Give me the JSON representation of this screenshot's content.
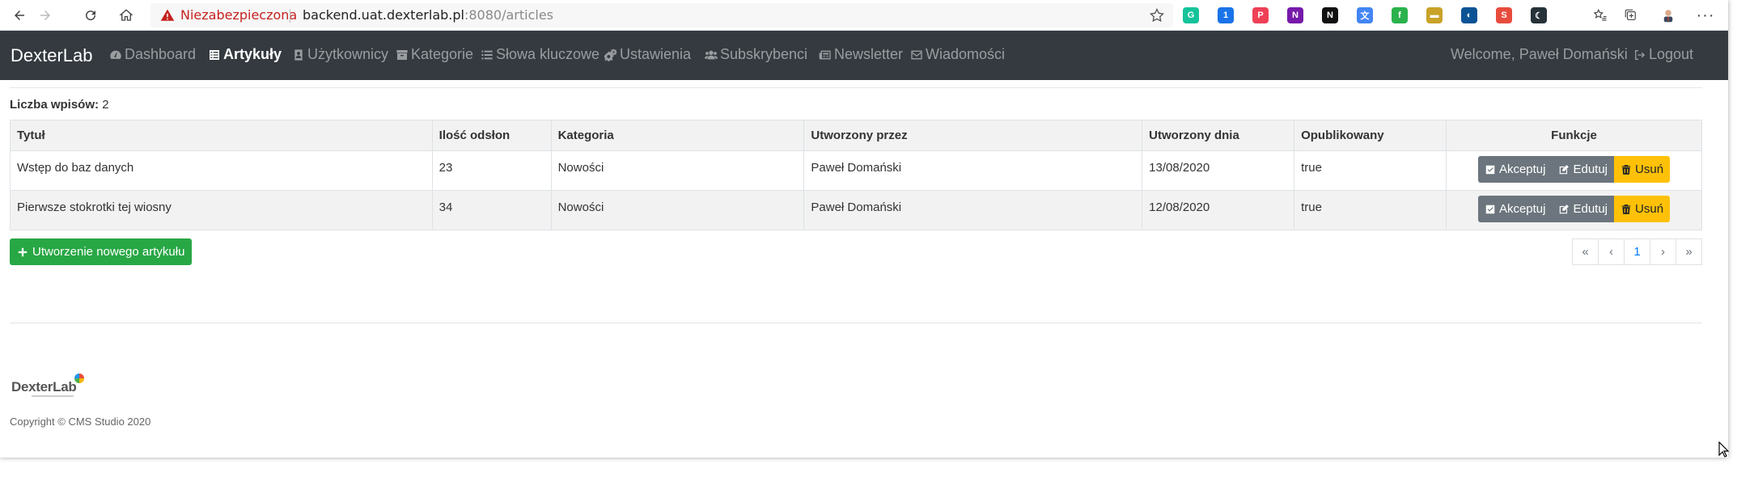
{
  "browser": {
    "security_label": "Niezabezpieczona",
    "url_host": "backend.uat.dexterlab.pl",
    "url_rest": ":8080/articles",
    "extensions": [
      {
        "name": "grammarly-icon",
        "glyph": "G",
        "color": "#15c39a"
      },
      {
        "name": "onepassword-icon",
        "glyph": "1",
        "color": "#1a73e8"
      },
      {
        "name": "pocket-icon",
        "glyph": "P",
        "color": "#ef4056"
      },
      {
        "name": "onenote-icon",
        "glyph": "N",
        "color": "#7719aa"
      },
      {
        "name": "notion-icon",
        "glyph": "N",
        "color": "#111111"
      },
      {
        "name": "translate-icon",
        "glyph": "文",
        "color": "#4285f4"
      },
      {
        "name": "feedly-icon",
        "glyph": "f",
        "color": "#2bb24c"
      },
      {
        "name": "ext-bar-icon",
        "glyph": "▬",
        "color": "#c9a227"
      },
      {
        "name": "ext-circle-icon",
        "glyph": "◐",
        "color": "#0b5394"
      },
      {
        "name": "ext-badge-icon",
        "glyph": "S",
        "color": "#e74c3c"
      },
      {
        "name": "ext-moon-icon",
        "glyph": "☾",
        "color": "#263238"
      }
    ]
  },
  "nav": {
    "brand": "DexterLab",
    "items": [
      {
        "label": "Dashboard",
        "icon": "dashboard-icon",
        "active": false
      },
      {
        "label": "Artykuły",
        "icon": "list-icon",
        "active": true
      },
      {
        "label": "Użytkownicy",
        "icon": "user-card-icon",
        "active": false
      },
      {
        "label": "Kategorie",
        "icon": "archive-icon",
        "active": false
      },
      {
        "label": "Słowa kluczowe",
        "icon": "list-ul-icon",
        "active": false
      },
      {
        "label": "Ustawienia",
        "icon": "cogs-icon",
        "active": false
      },
      {
        "label": "Subskrybenci",
        "icon": "users-icon",
        "active": false
      },
      {
        "label": "Newsletter",
        "icon": "newspaper-icon",
        "active": false
      },
      {
        "label": "Wiadomości",
        "icon": "envelope-icon",
        "active": false
      }
    ],
    "welcome": "Welcome, Paweł Domański",
    "logout": "Logout"
  },
  "count": {
    "label": "Liczba wpisów:",
    "value": "2"
  },
  "table": {
    "headers": [
      "Tytuł",
      "Ilość odsłon",
      "Kategoria",
      "Utworzony przez",
      "Utworzony dnia",
      "Opublikowany",
      "Funkcje"
    ],
    "rows": [
      {
        "title": "Wstęp do baz danych",
        "views": "23",
        "category": "Nowości",
        "author": "Paweł Domański",
        "date": "13/08/2020",
        "published": "true"
      },
      {
        "title": "Pierwsze stokrotki tej wiosny",
        "views": "34",
        "category": "Nowości",
        "author": "Paweł Domański",
        "date": "12/08/2020",
        "published": "true"
      }
    ],
    "actions": {
      "accept": "Akceptuj",
      "edit": "Edutuj",
      "delete": "Usuń"
    }
  },
  "create_button": "Utworzenie nowego artykułu",
  "pagination": {
    "first": "«",
    "prev": "‹",
    "current": "1",
    "next": "›",
    "last": "»"
  },
  "footer": {
    "logo_text": "DexterLab",
    "copyright": "Copyright © CMS Studio 2020"
  },
  "colors": {
    "navbar": "#343a40",
    "success": "#28a745",
    "secondary": "#6c757d",
    "warning": "#ffc107",
    "danger_text": "#c5221f"
  }
}
